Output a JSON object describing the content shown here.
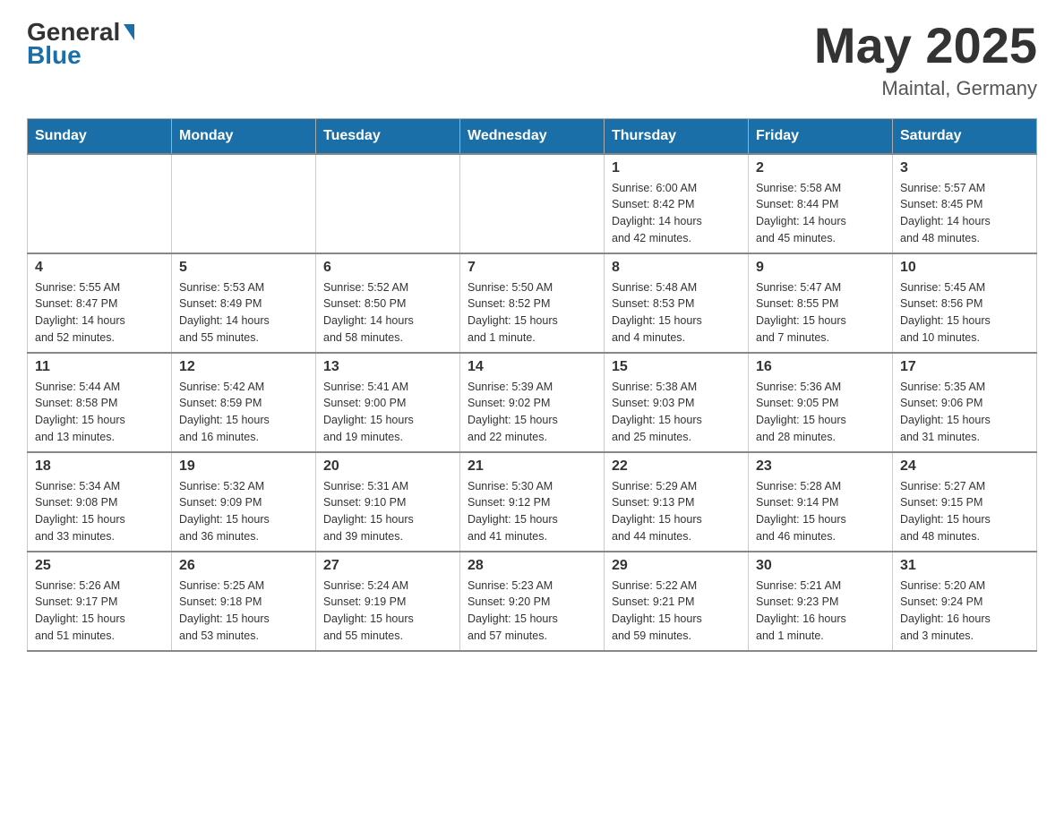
{
  "header": {
    "logo_general": "General",
    "logo_blue": "Blue",
    "month_title": "May 2025",
    "location": "Maintal, Germany"
  },
  "weekdays": [
    "Sunday",
    "Monday",
    "Tuesday",
    "Wednesday",
    "Thursday",
    "Friday",
    "Saturday"
  ],
  "weeks": [
    [
      {
        "day": "",
        "info": ""
      },
      {
        "day": "",
        "info": ""
      },
      {
        "day": "",
        "info": ""
      },
      {
        "day": "",
        "info": ""
      },
      {
        "day": "1",
        "info": "Sunrise: 6:00 AM\nSunset: 8:42 PM\nDaylight: 14 hours\nand 42 minutes."
      },
      {
        "day": "2",
        "info": "Sunrise: 5:58 AM\nSunset: 8:44 PM\nDaylight: 14 hours\nand 45 minutes."
      },
      {
        "day": "3",
        "info": "Sunrise: 5:57 AM\nSunset: 8:45 PM\nDaylight: 14 hours\nand 48 minutes."
      }
    ],
    [
      {
        "day": "4",
        "info": "Sunrise: 5:55 AM\nSunset: 8:47 PM\nDaylight: 14 hours\nand 52 minutes."
      },
      {
        "day": "5",
        "info": "Sunrise: 5:53 AM\nSunset: 8:49 PM\nDaylight: 14 hours\nand 55 minutes."
      },
      {
        "day": "6",
        "info": "Sunrise: 5:52 AM\nSunset: 8:50 PM\nDaylight: 14 hours\nand 58 minutes."
      },
      {
        "day": "7",
        "info": "Sunrise: 5:50 AM\nSunset: 8:52 PM\nDaylight: 15 hours\nand 1 minute."
      },
      {
        "day": "8",
        "info": "Sunrise: 5:48 AM\nSunset: 8:53 PM\nDaylight: 15 hours\nand 4 minutes."
      },
      {
        "day": "9",
        "info": "Sunrise: 5:47 AM\nSunset: 8:55 PM\nDaylight: 15 hours\nand 7 minutes."
      },
      {
        "day": "10",
        "info": "Sunrise: 5:45 AM\nSunset: 8:56 PM\nDaylight: 15 hours\nand 10 minutes."
      }
    ],
    [
      {
        "day": "11",
        "info": "Sunrise: 5:44 AM\nSunset: 8:58 PM\nDaylight: 15 hours\nand 13 minutes."
      },
      {
        "day": "12",
        "info": "Sunrise: 5:42 AM\nSunset: 8:59 PM\nDaylight: 15 hours\nand 16 minutes."
      },
      {
        "day": "13",
        "info": "Sunrise: 5:41 AM\nSunset: 9:00 PM\nDaylight: 15 hours\nand 19 minutes."
      },
      {
        "day": "14",
        "info": "Sunrise: 5:39 AM\nSunset: 9:02 PM\nDaylight: 15 hours\nand 22 minutes."
      },
      {
        "day": "15",
        "info": "Sunrise: 5:38 AM\nSunset: 9:03 PM\nDaylight: 15 hours\nand 25 minutes."
      },
      {
        "day": "16",
        "info": "Sunrise: 5:36 AM\nSunset: 9:05 PM\nDaylight: 15 hours\nand 28 minutes."
      },
      {
        "day": "17",
        "info": "Sunrise: 5:35 AM\nSunset: 9:06 PM\nDaylight: 15 hours\nand 31 minutes."
      }
    ],
    [
      {
        "day": "18",
        "info": "Sunrise: 5:34 AM\nSunset: 9:08 PM\nDaylight: 15 hours\nand 33 minutes."
      },
      {
        "day": "19",
        "info": "Sunrise: 5:32 AM\nSunset: 9:09 PM\nDaylight: 15 hours\nand 36 minutes."
      },
      {
        "day": "20",
        "info": "Sunrise: 5:31 AM\nSunset: 9:10 PM\nDaylight: 15 hours\nand 39 minutes."
      },
      {
        "day": "21",
        "info": "Sunrise: 5:30 AM\nSunset: 9:12 PM\nDaylight: 15 hours\nand 41 minutes."
      },
      {
        "day": "22",
        "info": "Sunrise: 5:29 AM\nSunset: 9:13 PM\nDaylight: 15 hours\nand 44 minutes."
      },
      {
        "day": "23",
        "info": "Sunrise: 5:28 AM\nSunset: 9:14 PM\nDaylight: 15 hours\nand 46 minutes."
      },
      {
        "day": "24",
        "info": "Sunrise: 5:27 AM\nSunset: 9:15 PM\nDaylight: 15 hours\nand 48 minutes."
      }
    ],
    [
      {
        "day": "25",
        "info": "Sunrise: 5:26 AM\nSunset: 9:17 PM\nDaylight: 15 hours\nand 51 minutes."
      },
      {
        "day": "26",
        "info": "Sunrise: 5:25 AM\nSunset: 9:18 PM\nDaylight: 15 hours\nand 53 minutes."
      },
      {
        "day": "27",
        "info": "Sunrise: 5:24 AM\nSunset: 9:19 PM\nDaylight: 15 hours\nand 55 minutes."
      },
      {
        "day": "28",
        "info": "Sunrise: 5:23 AM\nSunset: 9:20 PM\nDaylight: 15 hours\nand 57 minutes."
      },
      {
        "day": "29",
        "info": "Sunrise: 5:22 AM\nSunset: 9:21 PM\nDaylight: 15 hours\nand 59 minutes."
      },
      {
        "day": "30",
        "info": "Sunrise: 5:21 AM\nSunset: 9:23 PM\nDaylight: 16 hours\nand 1 minute."
      },
      {
        "day": "31",
        "info": "Sunrise: 5:20 AM\nSunset: 9:24 PM\nDaylight: 16 hours\nand 3 minutes."
      }
    ]
  ]
}
